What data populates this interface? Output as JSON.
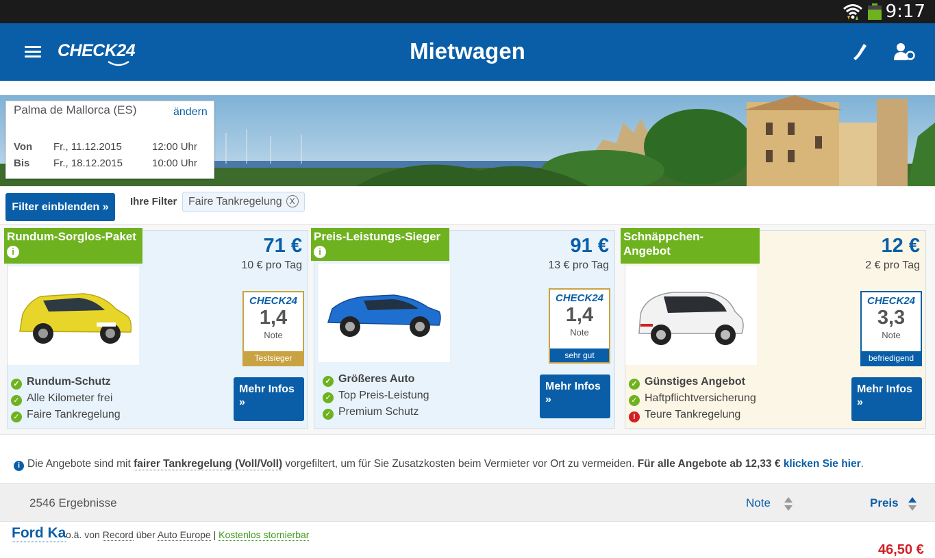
{
  "status_bar": {
    "time": "9:17"
  },
  "header": {
    "brand": "CHECK24",
    "title": "Mietwagen"
  },
  "search": {
    "location": "Palma de Mallorca (ES)",
    "change_label": "ändern",
    "from_label": "Von",
    "from_date": "Fr., 11.12.2015",
    "from_time": "12:00 Uhr",
    "to_label": "Bis",
    "to_date": "Fr., 18.12.2015",
    "to_time": "10:00 Uhr"
  },
  "filters": {
    "show_button": "Filter einblenden »",
    "label": "Ihre Filter",
    "chips": [
      "Faire Tankregelung"
    ],
    "chip_close": "X"
  },
  "cards": [
    {
      "tag": "Rundum-Sorglos-Paket",
      "price": "71 €",
      "per_day": "10 € pro Tag",
      "badge": {
        "logo": "CHECK24",
        "score": "1,4",
        "note": "Note",
        "footer": "Testsieger"
      },
      "features": [
        {
          "text": "Rundum-Schutz",
          "type": "check"
        },
        {
          "text": "Alle Kilometer frei",
          "type": "check"
        },
        {
          "text": "Faire Tankregelung",
          "type": "check"
        }
      ],
      "more": "Mehr Infos",
      "more_arrow": "»",
      "car_color": "#e8d52a"
    },
    {
      "tag": "Preis-Leistungs-Sieger",
      "price": "91 €",
      "per_day": "13 € pro Tag",
      "badge": {
        "logo": "CHECK24",
        "score": "1,4",
        "note": "Note",
        "footer": "sehr gut"
      },
      "features": [
        {
          "text": "Größeres Auto",
          "type": "check"
        },
        {
          "text": "Top Preis-Leistung",
          "type": "check"
        },
        {
          "text": "Premium Schutz",
          "type": "check"
        }
      ],
      "more": "Mehr Infos",
      "more_arrow": "»",
      "car_color": "#1f6fd0"
    },
    {
      "tag": "Schnäppchen-Angebot",
      "price": "12 €",
      "per_day": "2 € pro Tag",
      "badge": {
        "logo": "CHECK24",
        "score": "3,3",
        "note": "Note",
        "footer": "befriedigend"
      },
      "features": [
        {
          "text": "Günstiges Angebot",
          "type": "check"
        },
        {
          "text": "Haftpflichtversicherung",
          "type": "check"
        },
        {
          "text": "Teure Tankregelung",
          "type": "warning"
        }
      ],
      "more": "Mehr Infos",
      "more_arrow": "»",
      "car_color": "#f2f2f2"
    }
  ],
  "notice": {
    "part1": "Die Angebote sind mit ",
    "bold_underlined": "fairer Tankregelung (Voll/Voll)",
    "part2": " vorgefiltert, um für Sie Zusatzkosten beim Vermieter vor Ort zu vermeiden. ",
    "bold2": "Für alle Angebote ab 12,33 €",
    "link": "klicken Sie hier",
    "end": "."
  },
  "results": {
    "count": "2546 Ergebnisse",
    "sort_note": "Note",
    "sort_price": "Preis"
  },
  "first_result": {
    "title": "Ford Ka",
    "prefix": "o.ä. von ",
    "vendor": "Record",
    "via": " über ",
    "broker": "Auto Europe",
    "sep": " | ",
    "cancel": "Kostenlos stornierbar",
    "price": "46,50 €"
  },
  "colors": {
    "brand_blue": "#0a5ea8",
    "tag_green": "#6fb21f",
    "warning_red": "#d21f26"
  }
}
